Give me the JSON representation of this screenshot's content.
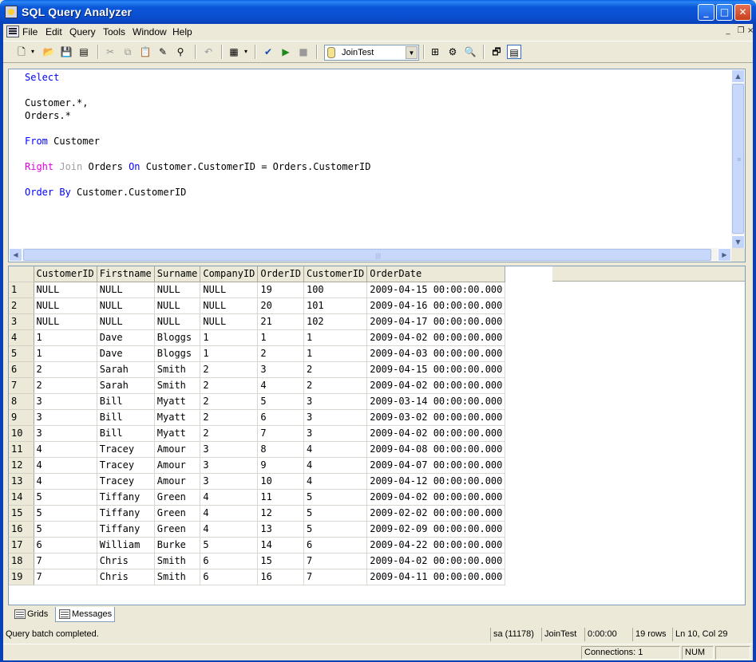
{
  "window": {
    "title": "SQL Query Analyzer"
  },
  "menu": {
    "items": [
      "File",
      "Edit",
      "Query",
      "Tools",
      "Window",
      "Help"
    ]
  },
  "toolbar": {
    "database": "JoinTest"
  },
  "editor": {
    "lines": [
      [
        {
          "t": "Select",
          "c": "kw"
        }
      ],
      [],
      [
        {
          "t": "Customer.*,",
          "c": ""
        }
      ],
      [
        {
          "t": "Orders.*",
          "c": ""
        }
      ],
      [],
      [
        {
          "t": "From",
          "c": "kw"
        },
        {
          "t": " Customer",
          "c": ""
        }
      ],
      [],
      [
        {
          "t": "Right",
          "c": "kw-mag"
        },
        {
          "t": " ",
          "c": ""
        },
        {
          "t": "Join",
          "c": "kw-grey"
        },
        {
          "t": " Orders ",
          "c": ""
        },
        {
          "t": "On",
          "c": "kw"
        },
        {
          "t": " Customer.CustomerID = Orders.CustomerID",
          "c": ""
        }
      ],
      [],
      [
        {
          "t": "Order",
          "c": "kw"
        },
        {
          "t": " ",
          "c": ""
        },
        {
          "t": "By",
          "c": "kw"
        },
        {
          "t": " Customer.CustomerID",
          "c": ""
        }
      ]
    ]
  },
  "results": {
    "columns": [
      "CustomerID",
      "Firstname",
      "Surname",
      "CompanyID",
      "OrderID",
      "CustomerID",
      "OrderDate"
    ],
    "rows": [
      [
        "1",
        "NULL",
        "NULL",
        "NULL",
        "NULL",
        "19",
        "100",
        "2009-04-15 00:00:00.000"
      ],
      [
        "2",
        "NULL",
        "NULL",
        "NULL",
        "NULL",
        "20",
        "101",
        "2009-04-16 00:00:00.000"
      ],
      [
        "3",
        "NULL",
        "NULL",
        "NULL",
        "NULL",
        "21",
        "102",
        "2009-04-17 00:00:00.000"
      ],
      [
        "4",
        "1",
        "Dave",
        "Bloggs",
        "1",
        "1",
        "1",
        "2009-04-02 00:00:00.000"
      ],
      [
        "5",
        "1",
        "Dave",
        "Bloggs",
        "1",
        "2",
        "1",
        "2009-04-03 00:00:00.000"
      ],
      [
        "6",
        "2",
        "Sarah",
        "Smith",
        "2",
        "3",
        "2",
        "2009-04-15 00:00:00.000"
      ],
      [
        "7",
        "2",
        "Sarah",
        "Smith",
        "2",
        "4",
        "2",
        "2009-04-02 00:00:00.000"
      ],
      [
        "8",
        "3",
        "Bill",
        "Myatt",
        "2",
        "5",
        "3",
        "2009-03-14 00:00:00.000"
      ],
      [
        "9",
        "3",
        "Bill",
        "Myatt",
        "2",
        "6",
        "3",
        "2009-03-02 00:00:00.000"
      ],
      [
        "10",
        "3",
        "Bill",
        "Myatt",
        "2",
        "7",
        "3",
        "2009-04-02 00:00:00.000"
      ],
      [
        "11",
        "4",
        "Tracey",
        "Amour",
        "3",
        "8",
        "4",
        "2009-04-08 00:00:00.000"
      ],
      [
        "12",
        "4",
        "Tracey",
        "Amour",
        "3",
        "9",
        "4",
        "2009-04-07 00:00:00.000"
      ],
      [
        "13",
        "4",
        "Tracey",
        "Amour",
        "3",
        "10",
        "4",
        "2009-04-12 00:00:00.000"
      ],
      [
        "14",
        "5",
        "Tiffany",
        "Green",
        "4",
        "11",
        "5",
        "2009-04-02 00:00:00.000"
      ],
      [
        "15",
        "5",
        "Tiffany",
        "Green",
        "4",
        "12",
        "5",
        "2009-02-02 00:00:00.000"
      ],
      [
        "16",
        "5",
        "Tiffany",
        "Green",
        "4",
        "13",
        "5",
        "2009-02-09 00:00:00.000"
      ],
      [
        "17",
        "6",
        "William",
        "Burke",
        "5",
        "14",
        "6",
        "2009-04-22 00:00:00.000"
      ],
      [
        "18",
        "7",
        "Chris",
        "Smith",
        "6",
        "15",
        "7",
        "2009-04-02 00:00:00.000"
      ],
      [
        "19",
        "7",
        "Chris",
        "Smith",
        "6",
        "16",
        "7",
        "2009-04-11 00:00:00.000"
      ]
    ]
  },
  "tabs": {
    "grids": "Grids",
    "messages": "Messages"
  },
  "status": {
    "message": "Query batch completed.",
    "user": "sa (11178)",
    "database": "JoinTest",
    "elapsed": "0:00:00",
    "rows": "19 rows",
    "position": "Ln 10, Col 29"
  },
  "appstatus": {
    "connections": "Connections: 1",
    "num": "NUM"
  }
}
